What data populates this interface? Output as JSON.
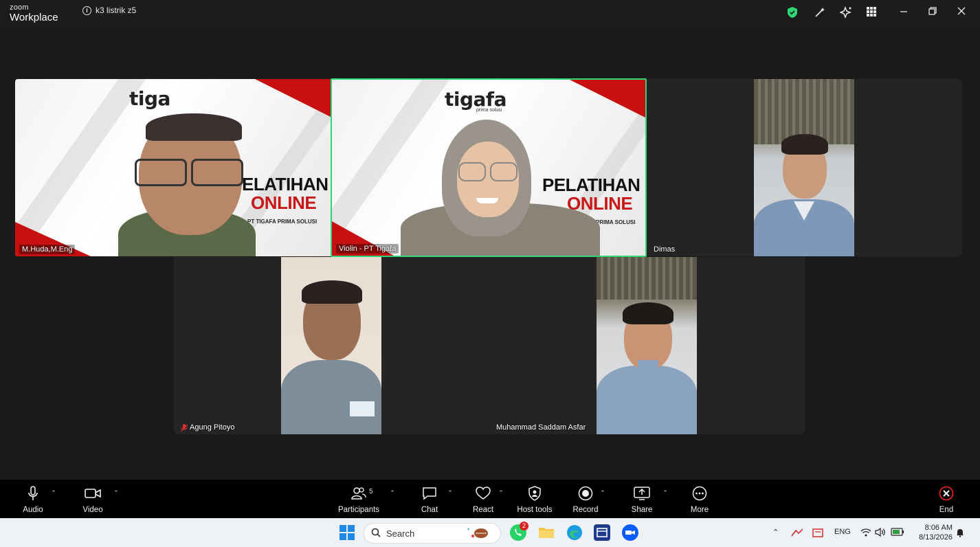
{
  "app": {
    "logo_line1": "zoom",
    "logo_line2": "Workplace",
    "meeting_title": "k3 listrik z5"
  },
  "participants": [
    {
      "name": "M.Huda,M.Eng",
      "muted": false
    },
    {
      "name": "Violin - PT Tigafa",
      "muted": false,
      "active_speaker": true
    },
    {
      "name": "Dimas",
      "muted": false
    },
    {
      "name": "Agung Pitoyo",
      "muted": true
    },
    {
      "name": "Muhammad Saddam Asfar",
      "muted": false
    }
  ],
  "banner": {
    "brand": "tigafa",
    "brand_partial": "tiga",
    "brand_sub": "prima solusi",
    "line1": "PELATIHAN",
    "line1_partial": "ELATIHAN",
    "line2": "ONLINE",
    "company": "PT TIGAFA PRIMA SOLUSI",
    "company_partial": "AFA PRIMA SOLUSI"
  },
  "toolbar": {
    "audio": "Audio",
    "video": "Video",
    "participants": "Participants",
    "participants_count": "5",
    "chat": "Chat",
    "react": "React",
    "host_tools": "Host tools",
    "record": "Record",
    "share": "Share",
    "more": "More",
    "end": "End"
  },
  "taskbar": {
    "search_placeholder": "Search",
    "whatsapp_badge": "2",
    "language": "ENG",
    "time": "8:06 AM",
    "date": "8/13/2026"
  },
  "colors": {
    "active_border": "#2ed573",
    "banner_red": "#c81010",
    "end_red": "#e02020"
  }
}
